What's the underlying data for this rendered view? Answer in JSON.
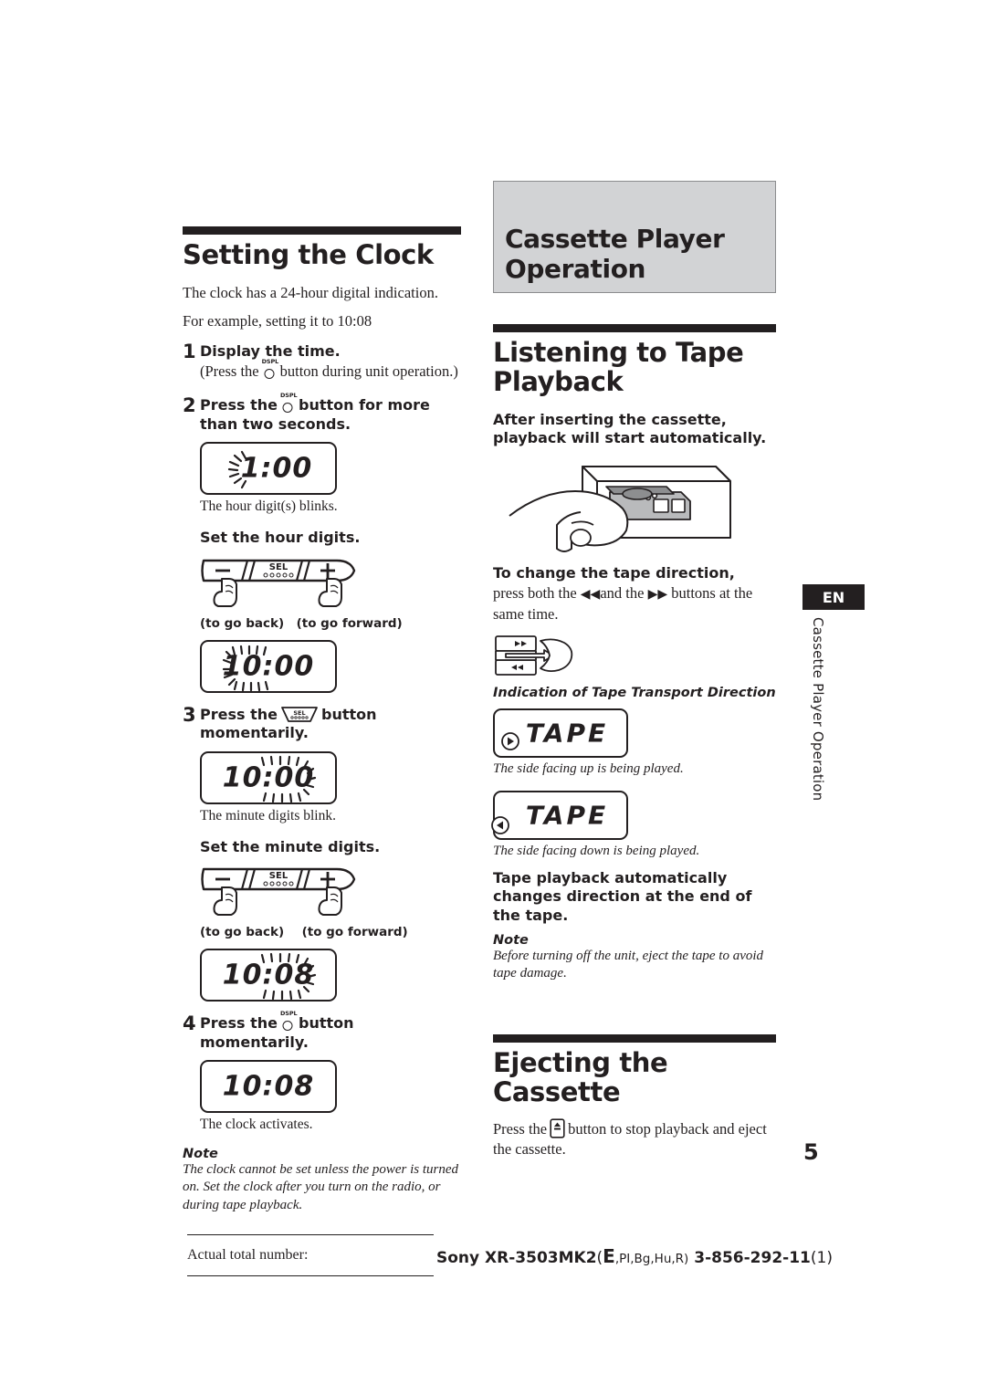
{
  "page": {
    "number": "5",
    "language_tab": "EN",
    "vertical_chapter": "Cassette Player Operation"
  },
  "left_column": {
    "heading": "Setting the Clock",
    "intro_line1": "The clock has a 24-hour digital indication.",
    "intro_line2": "For example, setting it to 10:08",
    "steps": [
      {
        "number": "1",
        "title": "Display the time.",
        "detail_before": "(Press the",
        "button": "DSPL",
        "detail_after": "button during  unit operation.)"
      },
      {
        "number": "2",
        "text_before": "Press the",
        "button": "DSPL",
        "text_after": "button for more than two seconds."
      },
      {
        "number": "3",
        "text_before": "Press the",
        "button": "SEL",
        "text_after": "button momentarily."
      },
      {
        "number": "4",
        "text_before": "Press the",
        "button": "DSPL",
        "text_after": "button momentarily."
      }
    ],
    "display_1": {
      "value": "1:00",
      "caption": "The hour digit(s) blinks."
    },
    "set_hour_label": "Set the hour digits.",
    "rocker_hour": {
      "minus": "–",
      "sel": "SEL",
      "plus": "+",
      "caption_back": "(to go back)",
      "caption_forward": "(to go forward)"
    },
    "display_2": {
      "value": "10:00",
      "caption": ""
    },
    "display_3": {
      "value": "10:00",
      "caption": "The minute digits blink."
    },
    "set_minute_label": "Set the minute digits.",
    "rocker_minute": {
      "minus": "–",
      "sel": "SEL",
      "plus": "+",
      "caption_back": "(to go back)",
      "caption_forward": "(to go forward)"
    },
    "display_4": {
      "value": "10:08",
      "caption": ""
    },
    "display_5": {
      "value": "10:08",
      "caption": "The clock activates."
    },
    "note": {
      "label": "Note",
      "text": "The clock cannot be set unless the power is turned on. Set the clock after you turn on the radio, or during tape playback."
    }
  },
  "right_column": {
    "chapter_title": "Cassette Player Operation",
    "heading_1": "Listening to Tape Playback",
    "lead_1": "After inserting the cassette, playback will start automatically.",
    "illustration_cassette": "cassette-insert-illustration",
    "direction_heading": "To change the tape direction,",
    "direction_text_pre": "press both the",
    "direction_btn_rew": "◀◀",
    "direction_text_mid": "and the",
    "direction_btn_ff": "▶▶",
    "direction_text_post": "buttons at the same time.",
    "direction_illustration": "tape-direction-rocker-illustration",
    "indication_label": "Indication of Tape Transport Direction",
    "tape_display_up": {
      "value": "TAPE",
      "arrow": "right",
      "caption": "The side facing up is being played."
    },
    "tape_display_down": {
      "value": "TAPE",
      "arrow": "left",
      "caption": "The side facing down is being played."
    },
    "auto_reverse_text": "Tape playback automatically changes direction at the end of the tape.",
    "note": {
      "label": "Note",
      "text": "Before turning off the unit, eject the tape to avoid tape damage."
    },
    "heading_2": "Ejecting the Cassette",
    "eject_text_pre": "Press the",
    "eject_button": "eject",
    "eject_text_post": "button to stop playback and eject the cassette."
  },
  "footer": {
    "label": "Actual total number:",
    "brand": "Sony",
    "model": "XR-3503MK2",
    "regions_open": "(",
    "region_primary": "E",
    "regions_rest": ",PI,Bg,Hu,R)",
    "part_number": "3-856-292-11",
    "revision": "(1)"
  },
  "colors": {
    "ink": "#231f20",
    "chapter_box_bg": "#d2d3d5",
    "chapter_box_border": "#8b8c8e",
    "page_bg": "#ffffff"
  }
}
